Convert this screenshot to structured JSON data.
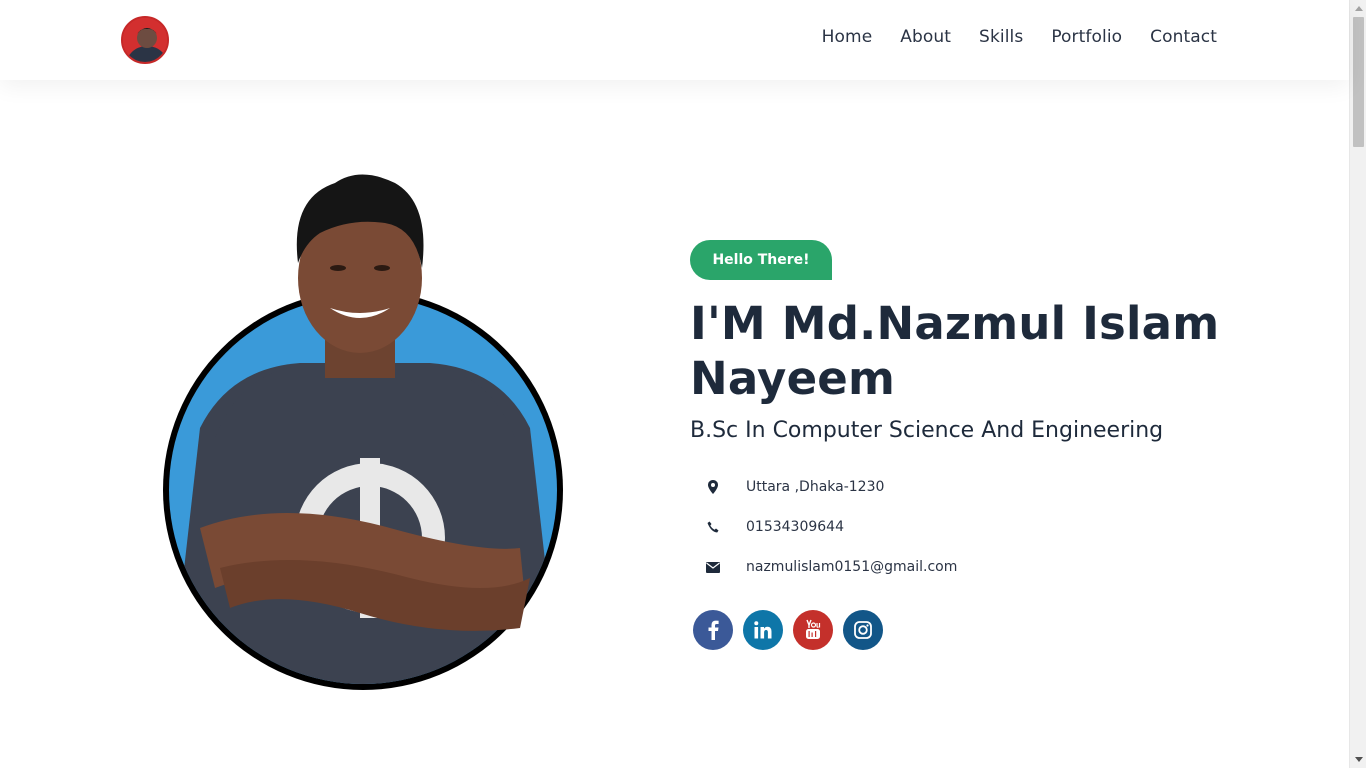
{
  "nav": {
    "logo_icon": "profile-avatar",
    "links": [
      "Home",
      "About",
      "Skills",
      "Portfolio",
      "Contact"
    ]
  },
  "hero": {
    "badge": "Hello There!",
    "name_line1": "I'M Md.Nazmul Islam",
    "name_line2": "Nayeem",
    "subtitle": "B.Sc In Computer Science And Engineering",
    "info": [
      {
        "icon": "map-marker-icon",
        "text": "Uttara ,Dhaka-1230"
      },
      {
        "icon": "phone-icon",
        "text": "01534309644"
      },
      {
        "icon": "envelope-icon",
        "text": "nazmulislam0151@gmail.com"
      }
    ],
    "socials": [
      {
        "icon": "facebook-icon",
        "color": "#3b5998"
      },
      {
        "icon": "linkedin-icon",
        "color": "#0e76a8"
      },
      {
        "icon": "youtube-icon",
        "color": "#c4302b"
      },
      {
        "icon": "instagram-icon",
        "color": "#125688"
      }
    ]
  },
  "colors": {
    "accent": "#2aa56a",
    "text": "#1e2a3b",
    "photo_circle": "#3a9ad9"
  }
}
